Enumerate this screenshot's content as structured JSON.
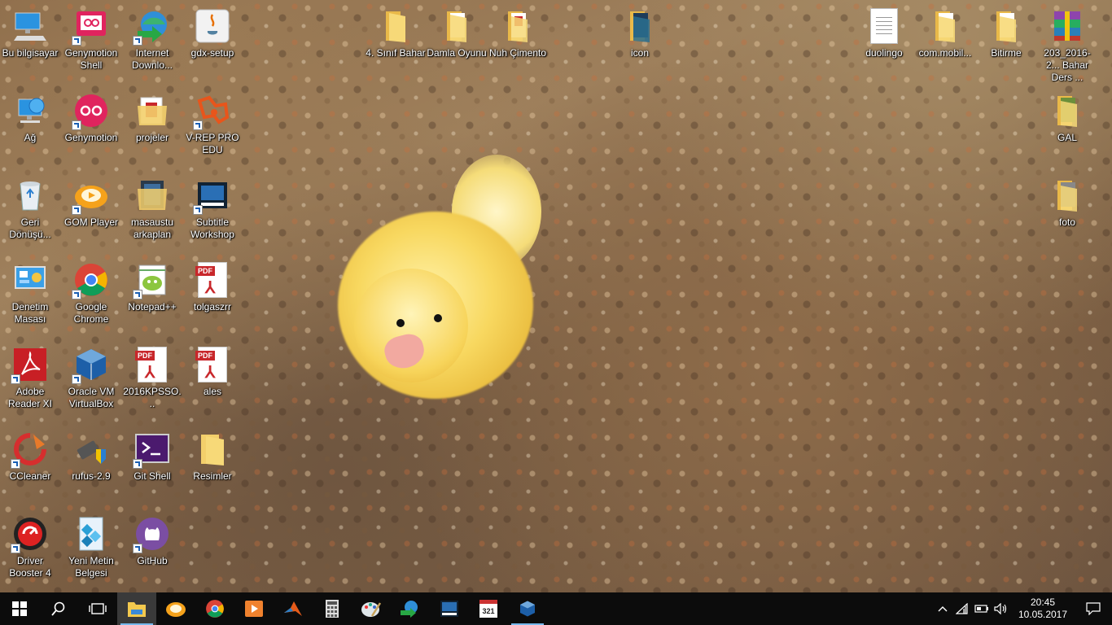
{
  "desktop_icons": [
    {
      "label": "Bu bilgisayar",
      "icon": "computer-icon"
    },
    {
      "label": "Genymotion Shell",
      "icon": "genymotion-shell-icon"
    },
    {
      "label": "Internet Downlo...",
      "icon": "internet-download-manager-icon"
    },
    {
      "label": "gdx-setup",
      "icon": "java-icon"
    },
    {
      "label": "4. Sınıf Bahar",
      "icon": "folder-icon"
    },
    {
      "label": "Damla Oyunu",
      "icon": "folder-icon"
    },
    {
      "label": "Nuh Çimento",
      "icon": "folder-icon"
    },
    {
      "label": "icon",
      "icon": "folder-icon"
    },
    {
      "label": "duolingo",
      "icon": "text-file-icon"
    },
    {
      "label": "com.mobil...",
      "icon": "folder-icon"
    },
    {
      "label": "Bitirme",
      "icon": "folder-icon"
    },
    {
      "label": "203_2016-2... Bahar Ders ...",
      "icon": "winrar-icon"
    },
    {
      "label": "Ağ",
      "icon": "network-icon"
    },
    {
      "label": "Genymotion",
      "icon": "genymotion-icon"
    },
    {
      "label": "projeler",
      "icon": "folder-icon"
    },
    {
      "label": "V-REP PRO EDU",
      "icon": "vrep-icon"
    },
    {
      "label": "GAL",
      "icon": "folder-icon"
    },
    {
      "label": "Geri Dönüşü...",
      "icon": "recycle-bin-icon"
    },
    {
      "label": "GOM Player",
      "icon": "gom-player-icon"
    },
    {
      "label": "masaustu arkaplan",
      "icon": "folder-icon"
    },
    {
      "label": "Subtitle Workshop",
      "icon": "subtitle-workshop-icon"
    },
    {
      "label": "foto",
      "icon": "folder-icon"
    },
    {
      "label": "Denetim Masası",
      "icon": "control-panel-icon"
    },
    {
      "label": "Google Chrome",
      "icon": "chrome-icon"
    },
    {
      "label": "Notepad++",
      "icon": "notepad-plus-plus-icon"
    },
    {
      "label": "tolgaszrr",
      "icon": "pdf-icon"
    },
    {
      "label": "Adobe Reader XI",
      "icon": "adobe-reader-icon"
    },
    {
      "label": "Oracle VM VirtualBox",
      "icon": "virtualbox-icon"
    },
    {
      "label": "2016KPSSO...",
      "icon": "pdf-icon"
    },
    {
      "label": "ales",
      "icon": "pdf-icon"
    },
    {
      "label": "CCleaner",
      "icon": "ccleaner-icon"
    },
    {
      "label": "rufus-2.9",
      "icon": "rufus-icon"
    },
    {
      "label": "Git Shell",
      "icon": "git-shell-icon"
    },
    {
      "label": "Resimler",
      "icon": "folder-icon"
    },
    {
      "label": "Driver Booster 4",
      "icon": "driver-booster-icon"
    },
    {
      "label": "Yeni Metin Belgesi",
      "icon": "text-file-icon"
    },
    {
      "label": "GitHub",
      "icon": "github-icon"
    }
  ],
  "taskbar": {
    "pinned": [
      {
        "name": "start-button",
        "icon": "windows-logo-icon"
      },
      {
        "name": "search-button",
        "icon": "search-icon"
      },
      {
        "name": "task-view-button",
        "icon": "task-view-icon"
      },
      {
        "name": "taskbar-file-explorer",
        "icon": "file-explorer-icon"
      },
      {
        "name": "taskbar-gom-player",
        "icon": "gom-player-icon"
      },
      {
        "name": "taskbar-chrome",
        "icon": "chrome-icon"
      },
      {
        "name": "taskbar-media-player",
        "icon": "media-player-icon"
      },
      {
        "name": "taskbar-matlab",
        "icon": "matlab-icon"
      },
      {
        "name": "taskbar-calculator",
        "icon": "calculator-icon"
      },
      {
        "name": "taskbar-paint",
        "icon": "paint-icon"
      },
      {
        "name": "taskbar-idm",
        "icon": "internet-download-manager-icon"
      },
      {
        "name": "taskbar-subtitle-workshop",
        "icon": "subtitle-workshop-icon"
      },
      {
        "name": "taskbar-calendar-321",
        "icon": "calendar-321-icon"
      },
      {
        "name": "taskbar-virtualbox",
        "icon": "virtualbox-icon"
      }
    ],
    "calendar_badge": "321",
    "clock": {
      "time": "20:45",
      "date": "10.05.2017"
    }
  },
  "colors": {
    "taskbar": "#0c0c0c",
    "accent": "#76b9ed"
  }
}
